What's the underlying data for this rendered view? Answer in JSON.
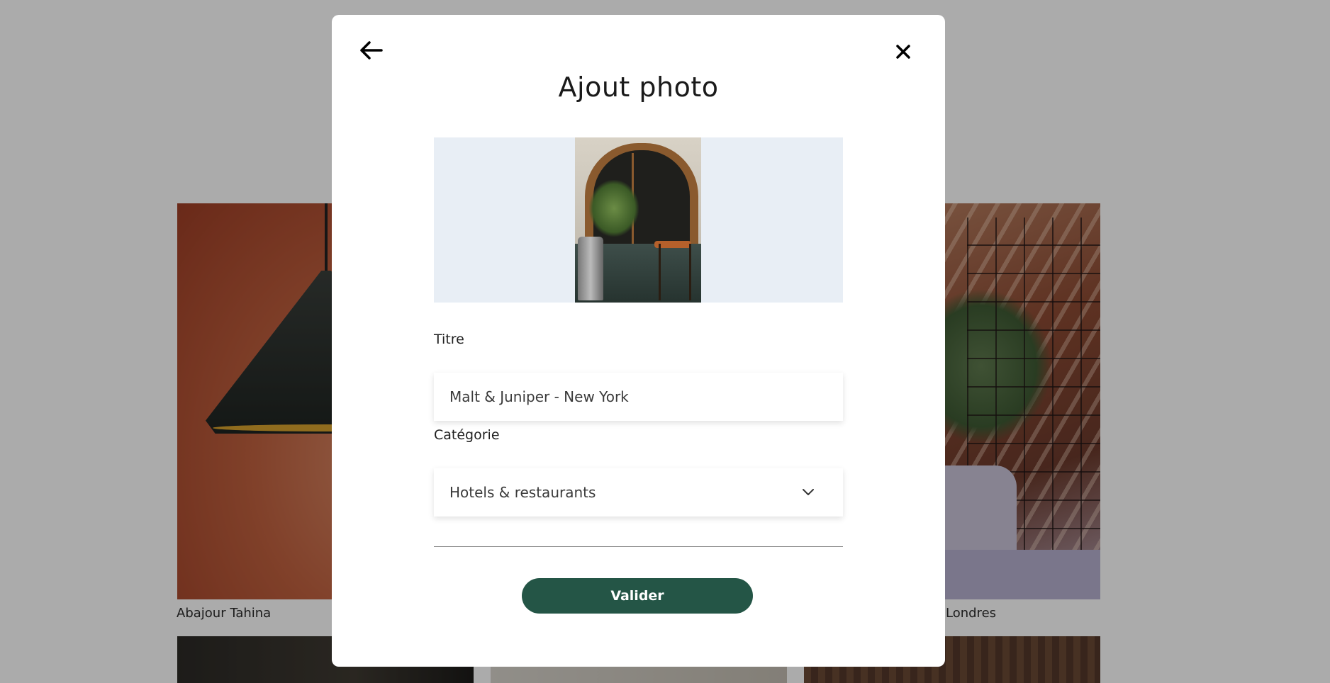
{
  "gallery": {
    "items": [
      {
        "caption": "Abajour Tahina"
      },
      {
        "caption": "Londres"
      }
    ]
  },
  "modal": {
    "title": "Ajout photo",
    "back_icon": "arrow-left-icon",
    "close_icon": "close-icon",
    "preview_alt": "Malt & Juniper - New York",
    "form": {
      "title_label": "Titre",
      "title_value": "Malt & Juniper - New York",
      "category_label": "Catégorie",
      "category_value": "Hotels & restaurants",
      "category_icon": "chevron-down-icon"
    },
    "submit_label": "Valider"
  },
  "colors": {
    "accent": "#245546",
    "preview_bg": "#e8eef5",
    "overlay": "rgba(0,0,0,0.33)"
  }
}
